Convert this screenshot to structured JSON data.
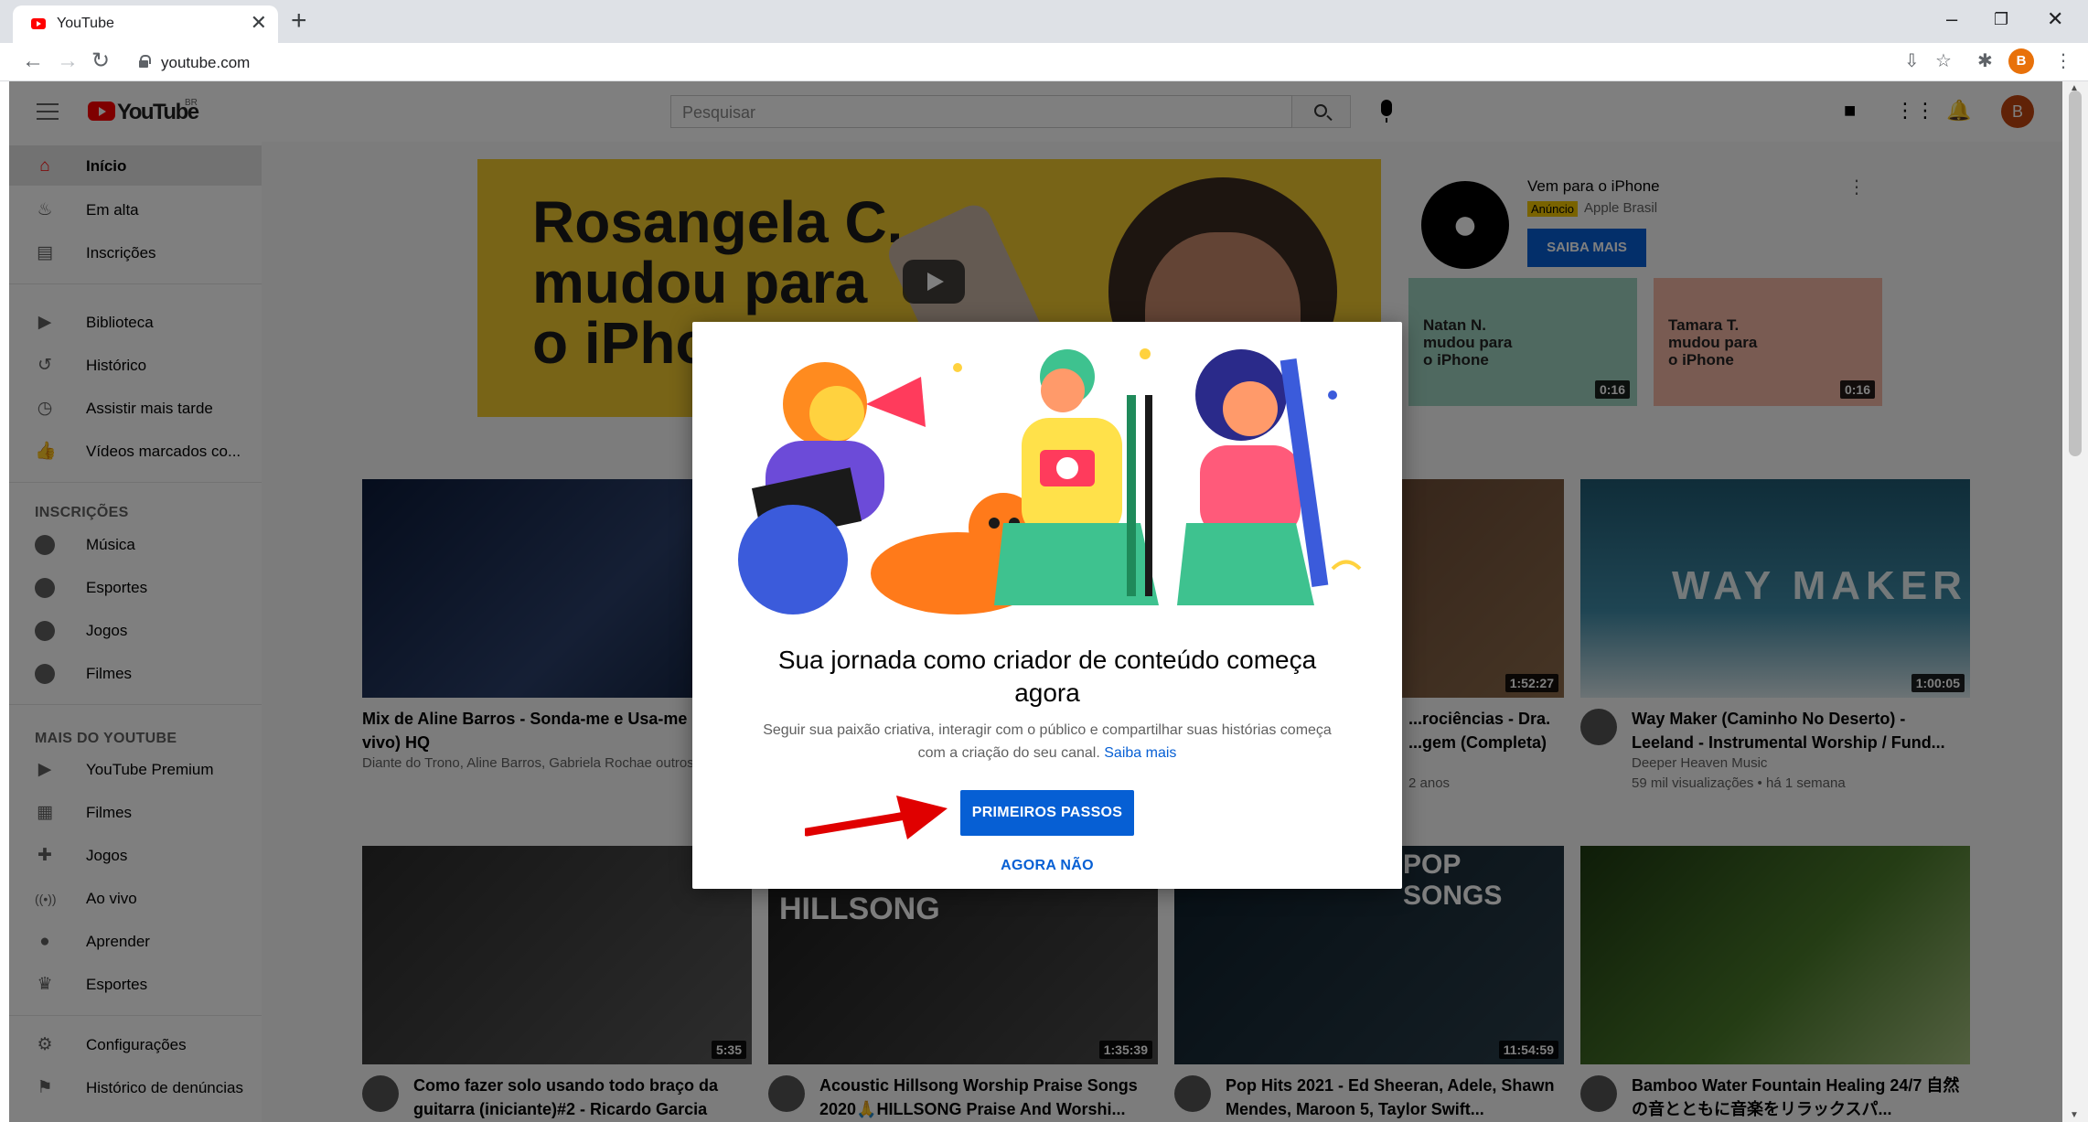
{
  "browser": {
    "tab_title": "YouTube",
    "tab_close": "✕",
    "new_tab": "+",
    "url": "youtube.com",
    "profile_initial": "B",
    "win_min": "–",
    "win_restore": "❐",
    "win_close": "✕"
  },
  "masthead": {
    "logo_word": "YouTube",
    "country": "BR",
    "search_placeholder": "Pesquisar",
    "avatar_initial": "B"
  },
  "sidebar": {
    "main": [
      {
        "label": "Início",
        "icon": "home-icon"
      },
      {
        "label": "Em alta",
        "icon": "flame-icon"
      },
      {
        "label": "Inscrições",
        "icon": "subscriptions-icon"
      }
    ],
    "library": [
      {
        "label": "Biblioteca",
        "icon": "library-icon"
      },
      {
        "label": "Histórico",
        "icon": "history-icon"
      },
      {
        "label": "Assistir mais tarde",
        "icon": "clock-icon"
      },
      {
        "label": "Vídeos marcados co...",
        "icon": "thumbs-up-icon"
      }
    ],
    "subs_heading": "INSCRIÇÕES",
    "subscriptions": [
      {
        "label": "Música"
      },
      {
        "label": "Esportes"
      },
      {
        "label": "Jogos"
      },
      {
        "label": "Filmes"
      }
    ],
    "more_heading": "MAIS DO YOUTUBE",
    "more": [
      {
        "label": "YouTube Premium",
        "icon": "youtube-icon"
      },
      {
        "label": "Filmes",
        "icon": "film-icon"
      },
      {
        "label": "Jogos",
        "icon": "gamepad-icon"
      },
      {
        "label": "Ao vivo",
        "icon": "live-icon"
      },
      {
        "label": "Aprender",
        "icon": "bulb-icon"
      },
      {
        "label": "Esportes",
        "icon": "trophy-icon"
      }
    ],
    "settings": [
      {
        "label": "Configurações",
        "icon": "gear-icon"
      },
      {
        "label": "Histórico de denúncias",
        "icon": "flag-icon"
      }
    ]
  },
  "ad": {
    "headline_1": "Rosangela C.",
    "headline_2": "mudou para",
    "headline_3": "o iPhone",
    "title": "Vem para o iPhone",
    "badge": "Anúncio",
    "advertiser": "Apple Brasil",
    "cta": "SAIBA MAIS",
    "thumbs": [
      {
        "text": "Natan N. mudou para o iPhone",
        "duration": "0:16"
      },
      {
        "text": "Tamara T. mudou para o iPhone",
        "duration": "0:16"
      }
    ]
  },
  "videos_row1": [
    {
      "title": "Mix de Aline Barros - Sonda-me e Usa-me (Ao vivo) HQ",
      "channel": "Diante do Trono, Aline Barros, Gabriela Rochae outros",
      "stats": "",
      "duration": ""
    },
    {
      "title": "",
      "channel": "",
      "stats": "",
      "duration": ""
    },
    {
      "title": "...rociências - Dra. ...gem (Completa)",
      "channel": "",
      "stats": "2 anos",
      "duration": "1:52:27"
    },
    {
      "title": "Way Maker (Caminho No Deserto) - Leeland - Instrumental Worship / Fund...",
      "channel": "Deeper Heaven Music",
      "stats": "59 mil visualizações • há 1 semana",
      "duration": "1:00:05",
      "thumb_text": "WAY MAKER"
    }
  ],
  "videos_row2": [
    {
      "title": "Como fazer solo usando todo braço da guitarra (iniciante)#2 - Ricardo Garcia",
      "duration": "5:35"
    },
    {
      "title": "Acoustic Hillsong Worship Praise Songs 2020🙏HILLSONG Praise And Worshi...",
      "duration": "1:35:39",
      "thumb_text": "HILLSONG"
    },
    {
      "title": "Pop Hits 2021 - Ed Sheeran, Adele, Shawn Mendes, Maroon 5, Taylor Swift...",
      "duration": "11:54:59",
      "thumb_text": "POP SONGS"
    },
    {
      "title": "Bamboo Water Fountain Healing 24/7 自然の音とともに音楽をリラックスパ...",
      "duration": ""
    }
  ],
  "modal": {
    "title": "Sua jornada como criador de conteúdo começa agora",
    "desc": "Seguir sua paixão criativa, interagir com o público e compartilhar suas histórias começa com a criação do seu canal.",
    "learn_more": "Saiba mais",
    "primary": "PRIMEIROS PASSOS",
    "secondary": "AGORA NÃO"
  },
  "colors": {
    "accent": "#065fd4",
    "brand": "#ff0000",
    "arrow": "#e00000"
  }
}
